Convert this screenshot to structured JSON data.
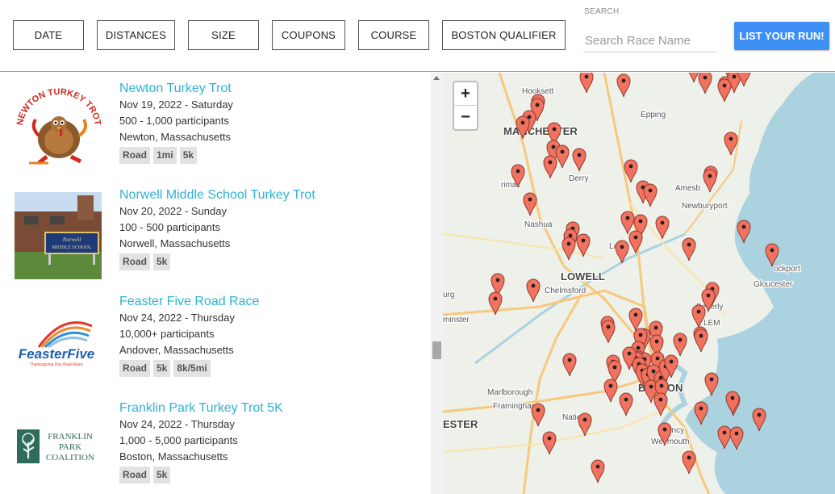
{
  "filters": {
    "date": "DATE",
    "distances": "DISTANCES",
    "size": "SIZE",
    "coupons": "COUPONS",
    "course": "COURSE",
    "boston_qualifier": "BOSTON QUALIFIER"
  },
  "search": {
    "label": "SEARCH",
    "placeholder": "Search Race Name"
  },
  "list_run_label": "LIST YOUR RUN!",
  "races": [
    {
      "title": "Newton Turkey Trot",
      "date": "Nov 19, 2022 - Saturday",
      "participants": "500 - 1,000 participants",
      "location": "Newton, Massachusetts",
      "tags": [
        "Road",
        "1mi",
        "5k"
      ]
    },
    {
      "title": "Norwell Middle School Turkey Trot",
      "date": "Nov 20, 2022 - Sunday",
      "participants": "100 - 500 participants",
      "location": "Norwell, Massachusetts",
      "tags": [
        "Road",
        "5k"
      ]
    },
    {
      "title": "Feaster Five Road Race",
      "date": "Nov 24, 2022 - Thursday",
      "participants": "10,000+ participants",
      "location": "Andover, Massachusetts",
      "tags": [
        "Road",
        "5k",
        "8k/5mi"
      ]
    },
    {
      "title": "Franklin Park Turkey Trot 5K",
      "date": "Nov 24, 2022 - Thursday",
      "participants": "1,000 - 5,000 participants",
      "location": "Boston, Massachusetts",
      "tags": [
        "Road",
        "5k"
      ]
    }
  ],
  "logos": {
    "newton": "NEWTON TURKEY TROT",
    "norwell": "Norwell MIDDLE SCHOOL",
    "feaster": "FeasterFive",
    "feaster_sub": "Thanksgiving Day Road Race",
    "franklin": [
      "FRANKLIN",
      "PARK",
      "COALITION"
    ]
  },
  "map": {
    "zoom_in": "+",
    "zoom_out": "−",
    "places": [
      {
        "name": "Hooksett",
        "major": false
      },
      {
        "name": "Epping",
        "major": false
      },
      {
        "name": "MANCHESTER",
        "major": true
      },
      {
        "name": "Derry",
        "major": false
      },
      {
        "name": "rimac",
        "major": false
      },
      {
        "name": "Amesb",
        "major": false
      },
      {
        "name": "Newburyport",
        "major": false
      },
      {
        "name": "Nashua",
        "major": false
      },
      {
        "name": "Lawr",
        "major": false
      },
      {
        "name": "LOWELL",
        "major": true
      },
      {
        "name": "Chelmsford",
        "major": false
      },
      {
        "name": "ockport",
        "major": false
      },
      {
        "name": "Gloucester",
        "major": false
      },
      {
        "name": "urg",
        "major": false
      },
      {
        "name": "minster",
        "major": false
      },
      {
        "name": "Beverly",
        "major": false
      },
      {
        "name": "LEM",
        "major": false
      },
      {
        "name": "Marlborough",
        "major": false
      },
      {
        "name": "Framingham",
        "major": false
      },
      {
        "name": "ESTER",
        "major": true
      },
      {
        "name": "Natick",
        "major": false
      },
      {
        "name": "BOSTON",
        "major": true
      },
      {
        "name": "Quincy",
        "major": false
      },
      {
        "name": "Weymouth",
        "major": false
      }
    ],
    "colors": {
      "pin": "#f2725f",
      "pin_stroke": "#8a3a2f",
      "water": "#aad3df",
      "land": "#eef0ea",
      "road": "#f6c97c"
    }
  }
}
